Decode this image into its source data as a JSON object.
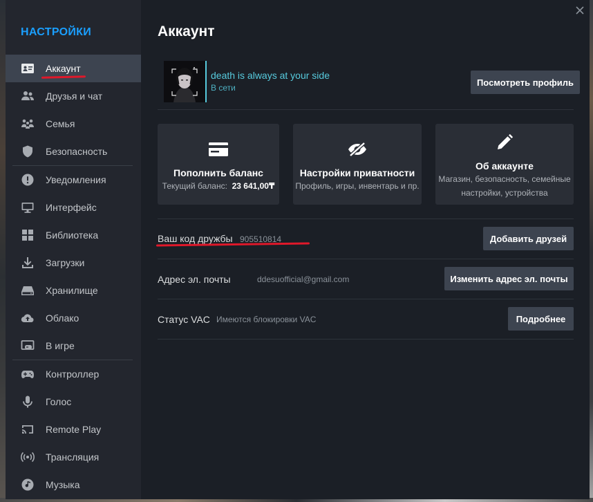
{
  "sidebar": {
    "title": "НАСТРОЙКИ",
    "items": [
      {
        "label": "Аккаунт",
        "icon": "id-card-icon"
      },
      {
        "label": "Друзья и чат",
        "icon": "friends-icon"
      },
      {
        "label": "Семья",
        "icon": "family-icon"
      },
      {
        "label": "Безопасность",
        "icon": "shield-icon"
      },
      {
        "label": "Уведомления",
        "icon": "alert-icon"
      },
      {
        "label": "Интерфейс",
        "icon": "monitor-icon"
      },
      {
        "label": "Библиотека",
        "icon": "grid-icon"
      },
      {
        "label": "Загрузки",
        "icon": "download-icon"
      },
      {
        "label": "Хранилище",
        "icon": "drive-icon"
      },
      {
        "label": "Облако",
        "icon": "cloud-sync-icon"
      },
      {
        "label": "В игре",
        "icon": "in-game-icon"
      },
      {
        "label": "Контроллер",
        "icon": "gamepad-icon"
      },
      {
        "label": "Голос",
        "icon": "microphone-icon"
      },
      {
        "label": "Remote Play",
        "icon": "cast-icon"
      },
      {
        "label": "Трансляция",
        "icon": "broadcast-icon"
      },
      {
        "label": "Музыка",
        "icon": "music-icon"
      }
    ]
  },
  "page": {
    "title": "Аккаунт"
  },
  "profile": {
    "persona_name": "death is always at your side",
    "status": "В сети",
    "view_profile_button": "Посмотреть профиль"
  },
  "cards": [
    {
      "title": "Пополнить баланс",
      "subtitle": "Текущий баланс:",
      "value": "23 641,00₸",
      "icon": "wallet-card-icon"
    },
    {
      "title": "Настройки приватности",
      "subtitle": "Профиль, игры, инвентарь и пр.",
      "icon": "eye-off-icon"
    },
    {
      "title": "Об аккаунте",
      "subtitle": "Магазин, безопасность, семейные настройки, устройства",
      "icon": "pencil-icon"
    }
  ],
  "rows": {
    "friend_code": {
      "label": "Ваш код дружбы",
      "value": "905510814",
      "button": "Добавить друзей"
    },
    "email": {
      "label": "Адрес эл. почты",
      "value": "ddesuofficial@gmail.com",
      "button": "Изменить адрес эл. почты"
    },
    "vac": {
      "label": "Статус VAC",
      "value": "Имеются блокировки VAC",
      "button": "Подробнее"
    }
  },
  "colors": {
    "accent": "#1a9fff",
    "online": "#57cbde",
    "annotation_red": "#e0182a"
  }
}
